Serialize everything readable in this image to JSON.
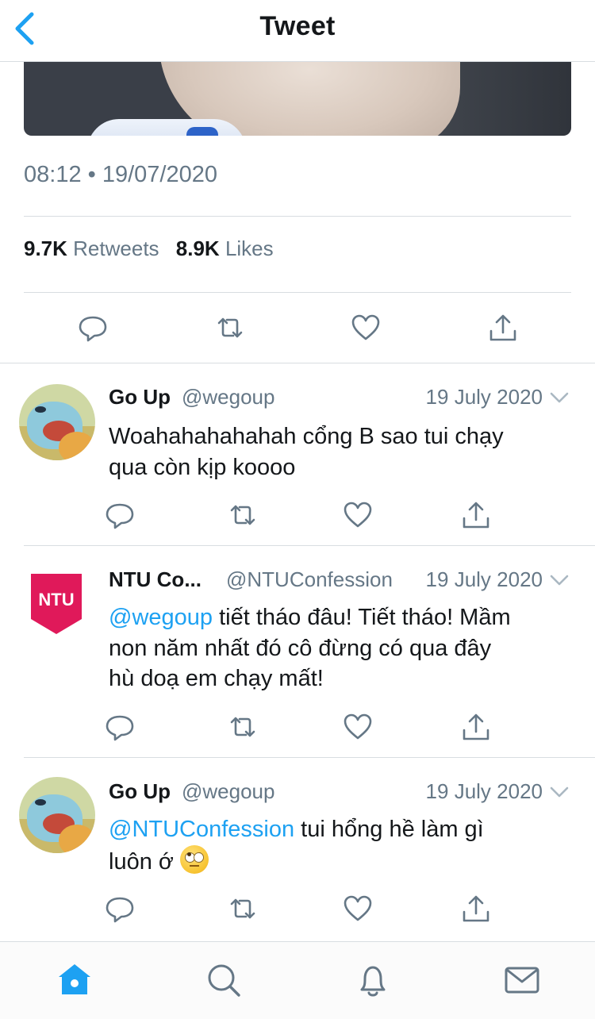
{
  "header": {
    "title": "Tweet"
  },
  "main_tweet": {
    "timestamp": "08:12 • 19/07/2020",
    "retweets_count": "9.7K",
    "retweets_label": "Retweets",
    "likes_count": "8.9K",
    "likes_label": "Likes"
  },
  "replies": [
    {
      "name": "Go Up",
      "handle": "@wegoup",
      "date": "19 July 2020",
      "mention": "",
      "text_line1": "Woahahahahahah cổng B sao tui chạy",
      "text_line2": "qua còn kịp koooo"
    },
    {
      "name": "NTU Co...",
      "handle": "@NTUConfession",
      "date": "19 July 2020",
      "logo_text": "NTU",
      "logo_color": "#e0195a",
      "mention": "@wegoup",
      "text_line1": " tiết tháo đâu! Tiết tháo! Mầm",
      "text_line2": "non năm nhất đó cô đừng có qua đây",
      "text_line3": "hù doạ em chạy mất!"
    },
    {
      "name": "Go Up",
      "handle": "@wegoup",
      "date": "19 July 2020",
      "mention": "@NTUConfession",
      "text_line1": " tui hổng hề làm gì",
      "text_line2": "luôn ớ",
      "emoji": "face-with-rolling-eyes"
    }
  ],
  "icons": {
    "back": "chevron-left-icon",
    "reply": "reply-icon",
    "retweet": "retweet-icon",
    "like": "heart-icon",
    "share": "share-icon",
    "more": "chevron-down-icon",
    "tab_home": "home-icon",
    "tab_search": "search-icon",
    "tab_notifications": "bell-icon",
    "tab_messages": "mail-icon"
  },
  "colors": {
    "accent": "#1da1f2",
    "text": "#14171a",
    "secondary": "#657786",
    "divider": "#d8dde1"
  }
}
